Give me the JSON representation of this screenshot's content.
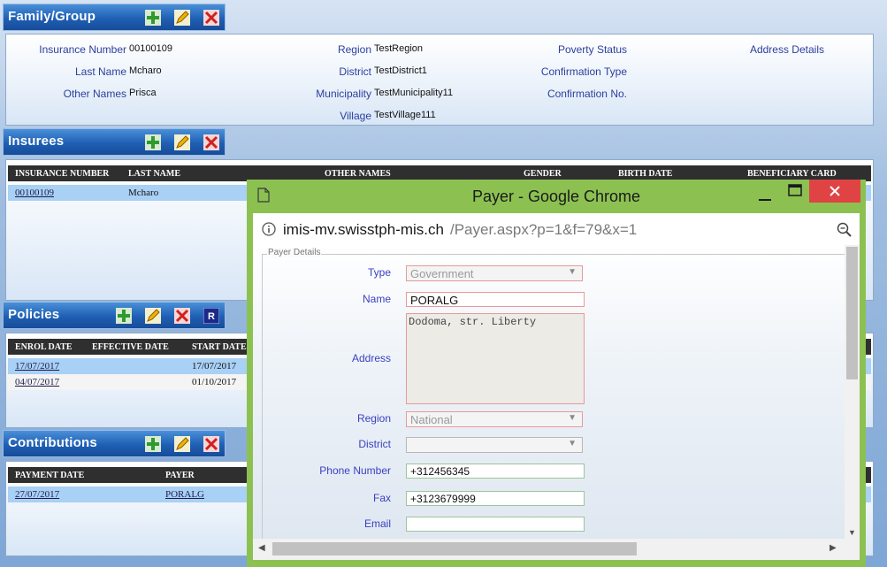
{
  "family": {
    "title": "Family/Group",
    "fields": {
      "insurance_number_label": "Insurance Number",
      "insurance_number": "00100109",
      "last_name_label": "Last Name",
      "last_name": "Mcharo",
      "other_names_label": "Other Names",
      "other_names": "Prisca",
      "region_label": "Region",
      "region": "TestRegion",
      "district_label": "District",
      "district": "TestDistrict1",
      "municipality_label": "Municipality",
      "municipality": "TestMunicipality11",
      "village_label": "Village",
      "village": "TestVillage111",
      "poverty_label": "Poverty Status",
      "confirmation_type_label": "Confirmation Type",
      "confirmation_no_label": "Confirmation No.",
      "address_details_label": "Address Details"
    }
  },
  "insurees": {
    "title": "Insurees",
    "columns": [
      "INSURANCE NUMBER",
      "LAST NAME",
      "OTHER NAMES",
      "GENDER",
      "BIRTH DATE",
      "BENEFICIARY CARD"
    ],
    "rows": [
      {
        "insurance_number": "00100109",
        "last_name": "Mcharo"
      }
    ]
  },
  "policies": {
    "title": "Policies",
    "columns": [
      "ENROL DATE",
      "EFFECTIVE DATE",
      "START DATE"
    ],
    "rows": [
      {
        "enrol_date": "17/07/2017",
        "effective_date": "",
        "start_date": "17/07/2017"
      },
      {
        "enrol_date": "04/07/2017",
        "effective_date": "",
        "start_date": "01/10/2017"
      }
    ]
  },
  "contributions": {
    "title": "Contributions",
    "columns": [
      "PAYMENT DATE",
      "PAYER"
    ],
    "rows": [
      {
        "payment_date": "27/07/2017",
        "payer": "PORALG"
      }
    ]
  },
  "popup": {
    "window_title": "Payer - Google Chrome",
    "url_host": "imis-mv.swisstph-mis.ch",
    "url_path": "/Payer.aspx?p=1&f=79&x=1",
    "fieldset_legend": "Payer Details",
    "type_label": "Type",
    "type_value": "Government",
    "name_label": "Name",
    "name_value": "PORALG",
    "address_label": "Address",
    "address_value": "Dodoma, str. Liberty",
    "region_label": "Region",
    "region_value": "National",
    "district_label": "District",
    "district_value": "",
    "phone_label": "Phone Number",
    "phone_value": "+312456345",
    "fax_label": "Fax",
    "fax_value": "+3123679999",
    "email_label": "Email",
    "email_value": ""
  },
  "colors": {
    "accent_blue": "#1f5fb4",
    "popup_frame": "#8cc152",
    "close_red": "#e04343",
    "required_border": "#e89a9a"
  },
  "icons": [
    "add-icon",
    "edit-icon",
    "delete-icon",
    "renew-icon",
    "page-icon",
    "minimize-icon",
    "maximize-icon",
    "close-icon",
    "info-icon",
    "zoom-icon"
  ]
}
